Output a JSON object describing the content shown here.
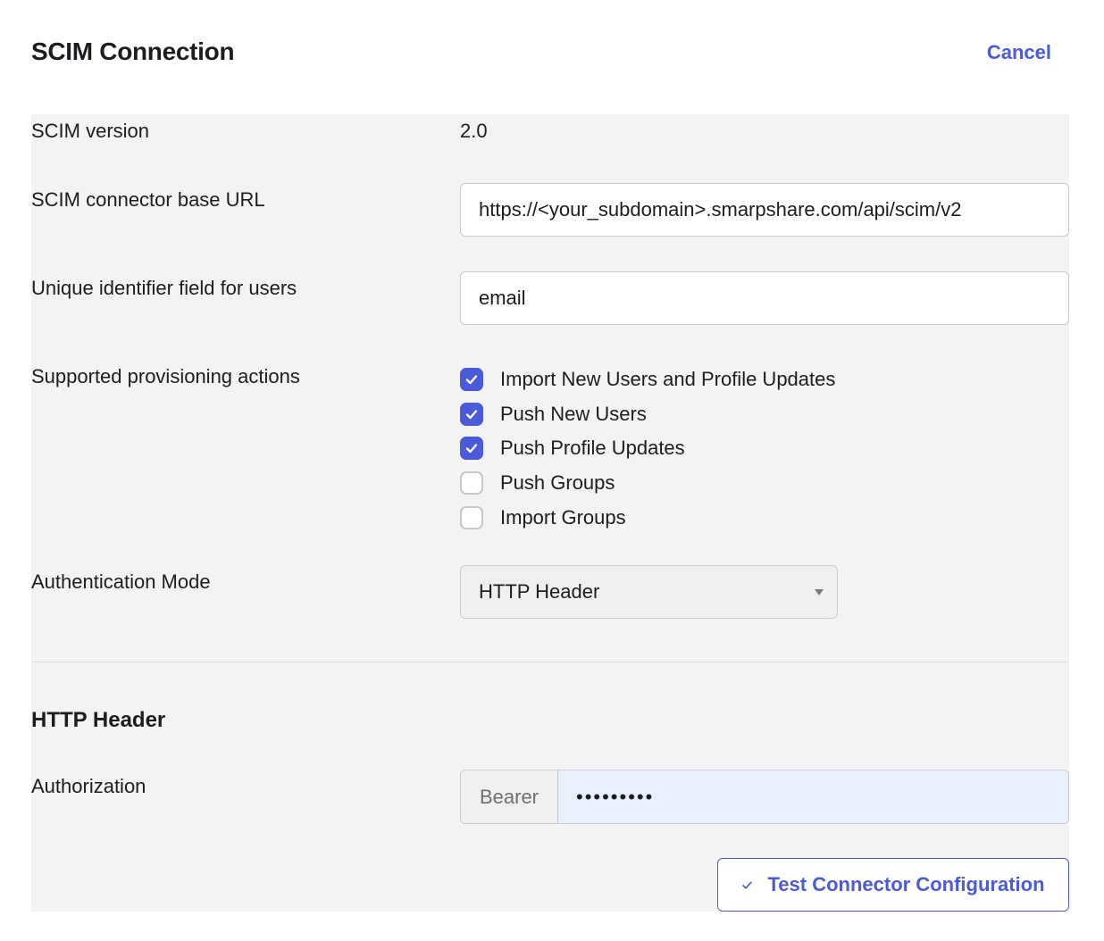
{
  "header": {
    "title": "SCIM Connection",
    "cancel_label": "Cancel"
  },
  "form": {
    "scim_version": {
      "label": "SCIM version",
      "value": "2.0"
    },
    "base_url": {
      "label": "SCIM connector base URL",
      "value": "https://<your_subdomain>.smarpshare.com/api/scim/v2"
    },
    "unique_id": {
      "label": "Unique identifier field for users",
      "value": "email"
    },
    "provisioning": {
      "label": "Supported provisioning actions",
      "options": [
        {
          "label": "Import New Users and Profile Updates",
          "checked": true
        },
        {
          "label": "Push New Users",
          "checked": true
        },
        {
          "label": "Push Profile Updates",
          "checked": true
        },
        {
          "label": "Push Groups",
          "checked": false
        },
        {
          "label": "Import Groups",
          "checked": false
        }
      ]
    },
    "auth_mode": {
      "label": "Authentication Mode",
      "selected": "HTTP Header"
    }
  },
  "http_header": {
    "section_title": "HTTP Header",
    "authorization": {
      "label": "Authorization",
      "prefix": "Bearer",
      "value": "•••••••••"
    }
  },
  "test_button": {
    "label": "Test Connector Configuration",
    "icon": "check-icon"
  },
  "colors": {
    "accent": "#4b5ad9",
    "panel_bg": "#f3f3f3",
    "autofill_bg": "#e8f0fe"
  }
}
